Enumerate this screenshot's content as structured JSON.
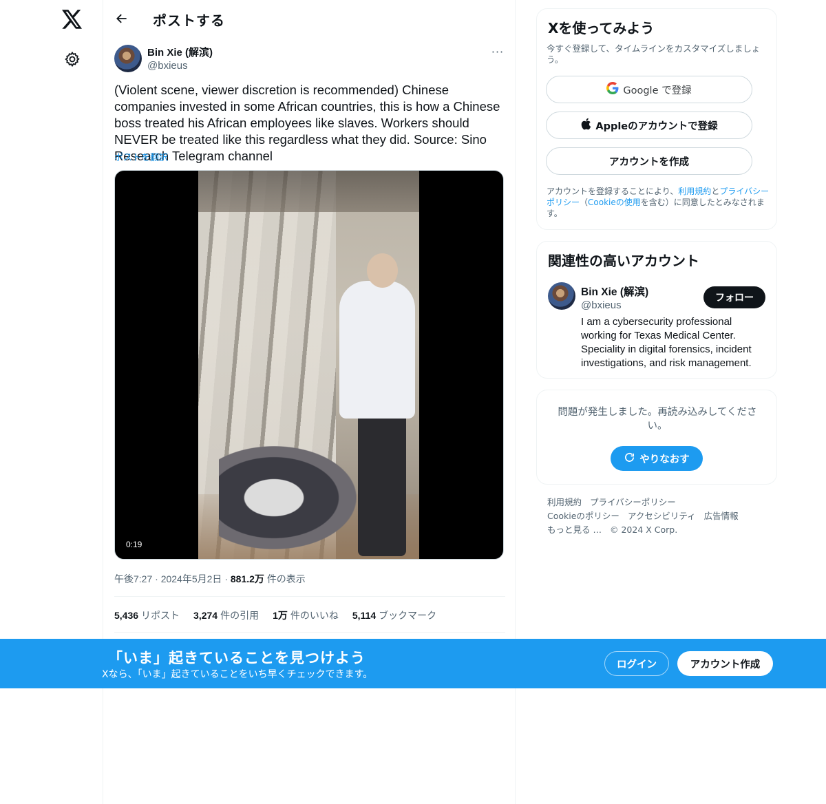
{
  "nav": {
    "logo_icon": "x-logo-icon",
    "settings_icon": "gear-icon"
  },
  "header": {
    "title": "ポストする",
    "back_icon": "arrow-left-icon"
  },
  "post": {
    "author_name": "Bin Xie (解滨)",
    "author_handle": "@bxieus",
    "more_label": "···",
    "text": "(Violent scene, viewer discretion is recommended) Chinese companies invested in some African countries, this is how a Chinese boss treated his African employees like slaves. Workers should NEVER be treated like this regardless what they did. Source: Sino Research Telegram channel",
    "translate_label": "ポストを翻訳",
    "video_duration": "0:19",
    "time": "午後7:27",
    "date": "2024年5月2日",
    "views_value": "881.2万",
    "views_label": "件の表示",
    "separator": "·",
    "stats": {
      "reposts_value": "5,436",
      "reposts_label": "リポスト",
      "quotes_value": "3,274",
      "quotes_label": "件の引用",
      "likes_value": "1万",
      "likes_label": "件のいいね",
      "bookmarks_value": "5,114",
      "bookmarks_label": "ブックマーク"
    }
  },
  "signup_card": {
    "title": "Xを使ってみよう",
    "subtitle": "今すぐ登録して、タイムラインをカスタマイズしましょう。",
    "google_label": "Google で登録",
    "apple_label": "Appleのアカウントで登録",
    "create_label": "アカウントを作成",
    "legal_prefix": "アカウントを登録することにより、",
    "legal_terms": "利用規約",
    "legal_and": "と",
    "legal_privacy": "プライバシーポリシー",
    "legal_open": "（",
    "legal_cookie": "Cookieの使用",
    "legal_suffix": "を含む）に同意したとみなされます。"
  },
  "related_card": {
    "title": "関連性の高いアカウント",
    "name": "Bin Xie (解滨)",
    "handle": "@bxieus",
    "follow_label": "フォロー",
    "bio": "I am a cybersecurity professional working for Texas Medical Center. Speciality in digital forensics, incident investigations, and risk management."
  },
  "error_card": {
    "message": "問題が発生しました。再読み込みしてください。",
    "retry_label": "やりなおす"
  },
  "footer": {
    "links": [
      "利用規約",
      "プライバシーポリシー",
      "Cookieのポリシー",
      "アクセシビリティ",
      "広告情報",
      "もっと見る …"
    ],
    "copyright": "© 2024 X Corp."
  },
  "banner": {
    "headline": "「いま」起きていることを見つけよう",
    "subline": "Xなら、「いま」起きていることをいち早くチェックできます。",
    "login_label": "ログイン",
    "signup_label": "アカウント作成"
  },
  "colors": {
    "accent": "#1d9bf0",
    "text": "#0f1419",
    "muted": "#536471"
  }
}
